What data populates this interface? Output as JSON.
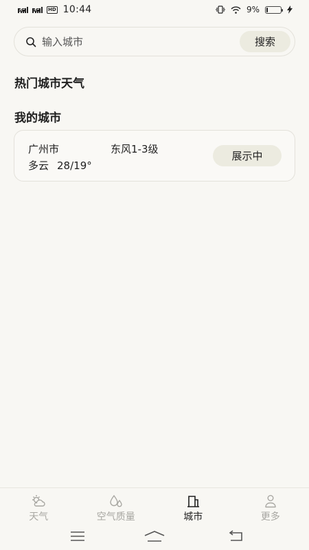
{
  "status_bar": {
    "network_5g": "5G",
    "network_4g": "4G",
    "hd": "HD",
    "time": "10:44",
    "battery_text": "9%",
    "battery_level": 0.09
  },
  "search": {
    "placeholder": "输入城市",
    "button_label": "搜索"
  },
  "sections": {
    "hot_cities_title": "热门城市天气",
    "my_cities_title": "我的城市"
  },
  "my_city": {
    "name": "广州市",
    "wind": "东风1-3级",
    "weather": "多云",
    "temperature": "28/19°",
    "status_button": "展示中"
  },
  "tabs": [
    {
      "label": "天气",
      "icon": "partly-cloudy-icon",
      "active": false
    },
    {
      "label": "空气质量",
      "icon": "droplets-icon",
      "active": false
    },
    {
      "label": "城市",
      "icon": "building-icon",
      "active": true
    },
    {
      "label": "更多",
      "icon": "person-icon",
      "active": false
    }
  ],
  "colors": {
    "background": "#f8f7f3",
    "button_bg": "#ecebe0",
    "active_tab": "#1f1f1f",
    "inactive_tab": "#a8a7a2"
  }
}
